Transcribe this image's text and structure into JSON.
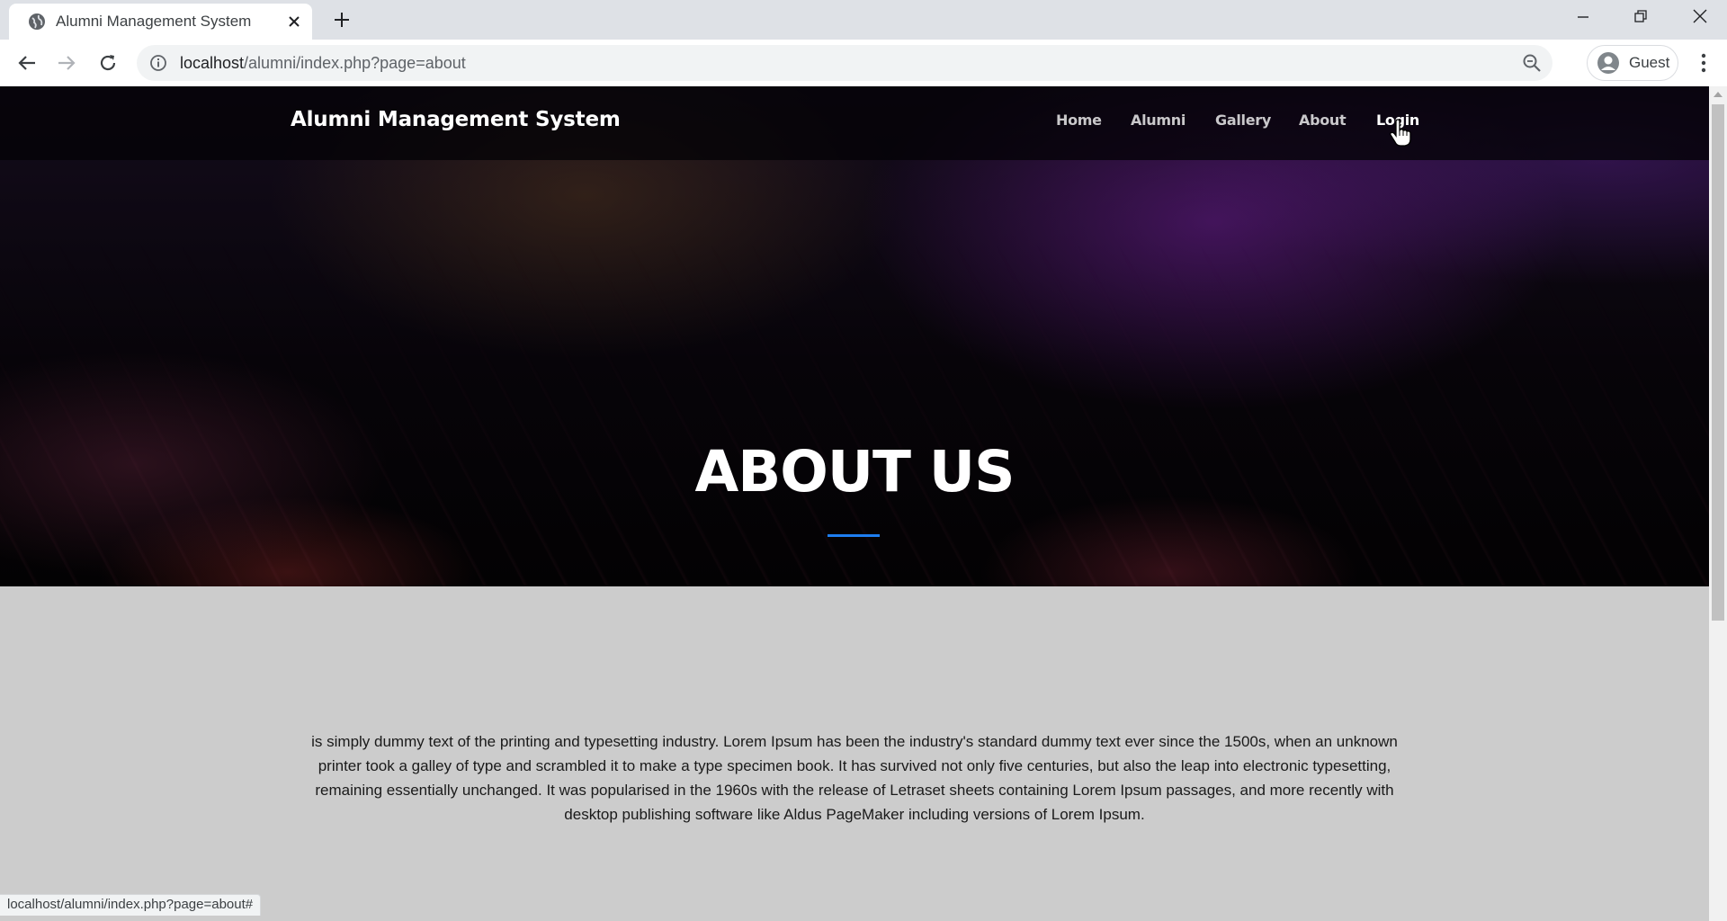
{
  "browser": {
    "tab_title": "Alumni Management System",
    "url_host": "localhost",
    "url_path": "/alumni/index.php?page=about",
    "profile_label": "Guest",
    "status_url": "localhost/alumni/index.php?page=about#"
  },
  "site": {
    "brand": "Alumni Management System",
    "nav": [
      {
        "label": "Home"
      },
      {
        "label": "Alumni"
      },
      {
        "label": "Gallery"
      },
      {
        "label": "About"
      },
      {
        "label": "Login"
      }
    ],
    "hovered_nav": "Login"
  },
  "hero": {
    "title": "ABOUT US",
    "divider_color": "#1e7ef0"
  },
  "about": {
    "text": "is simply dummy text of the printing and typesetting industry. Lorem Ipsum has been the industry's standard dummy text ever since the 1500s, when an unknown printer took a galley of type and scrambled it to make a type specimen book. It has survived not only five centuries, but also the leap into electronic typesetting, remaining essentially unchanged. It was popularised in the 1960s with the release of Letraset sheets containing Lorem Ipsum passages, and more recently with desktop publishing software like Aldus PageMaker including versions of Lorem Ipsum."
  },
  "icons": {
    "favicon": "globe-icon",
    "tab_close": "close-icon",
    "new_tab": "plus-icon",
    "back": "arrow-left-icon",
    "forward": "arrow-right-icon",
    "reload": "reload-icon",
    "site_info": "info-icon",
    "zoom": "zoom-icon",
    "avatar": "user-icon",
    "menu": "kebab-menu-icon",
    "cursor": "hand-pointer-icon"
  }
}
